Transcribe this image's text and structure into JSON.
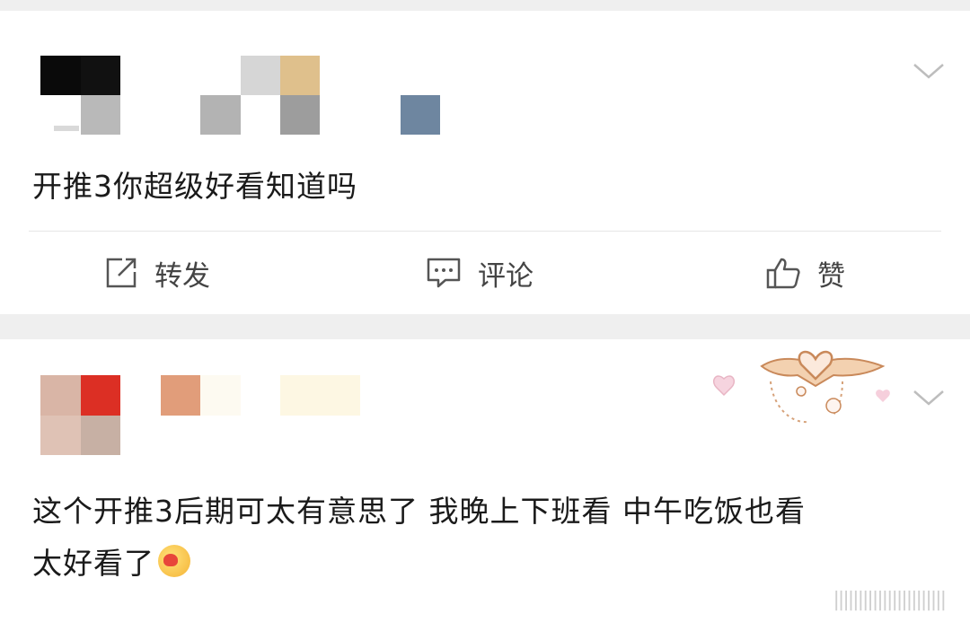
{
  "posts": [
    {
      "text": "开推3你超级好看知道吗",
      "actions": {
        "repost": "转发",
        "comment": "评论",
        "like": "赞"
      }
    },
    {
      "line1": "这个开推3后期可太有意思了 我晚上下班看 中午吃饭也看",
      "line2": "太好看了"
    }
  ],
  "icons": {
    "repost": "repost-icon",
    "comment": "comment-icon",
    "like": "thumbs-up-icon",
    "expand": "chevron-down-icon",
    "emoji": "heart-eyes-emoji-icon",
    "decoration": "heart-jewelry-decoration"
  },
  "colors": {
    "page_bg": "#efefef",
    "card_bg": "#ffffff",
    "text": "#1a1a1a",
    "action_text": "#444444"
  }
}
